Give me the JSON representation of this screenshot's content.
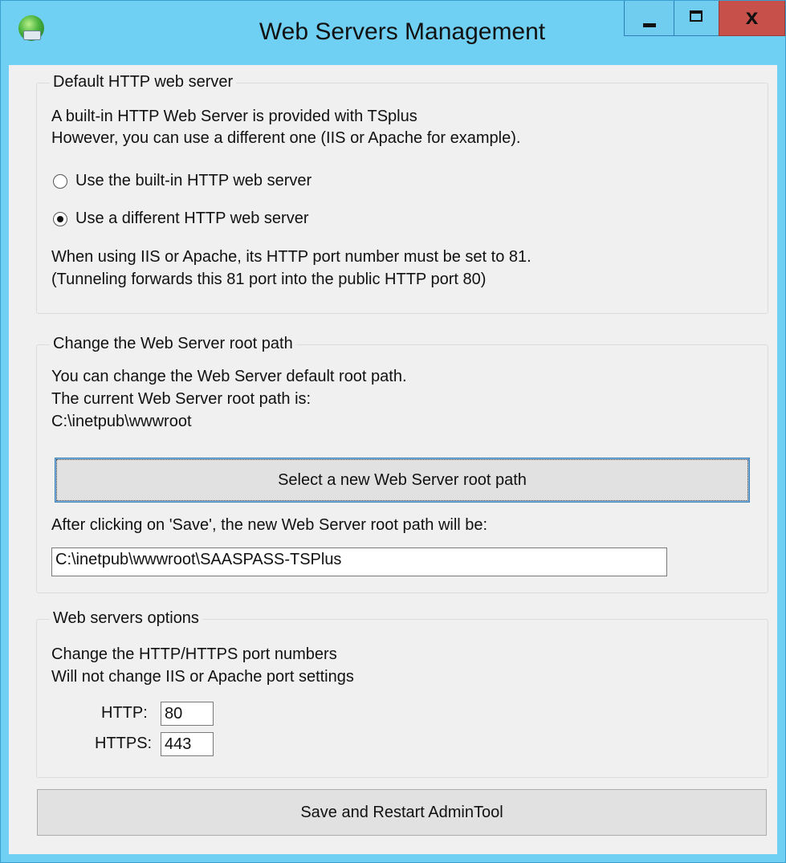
{
  "window": {
    "title": "Web Servers Management",
    "close_glyph": "x",
    "icon": "globe-server-icon"
  },
  "default_server": {
    "legend": "Default HTTP web server",
    "line1": "A built-in HTTP Web Server is provided with TSplus",
    "line2": "However, you can use a different one (IIS or Apache for example).",
    "radio_builtin_label": "Use the built-in HTTP web server",
    "radio_builtin_checked": false,
    "radio_different_label": "Use a different HTTP web server",
    "radio_different_checked": true,
    "note1": "When using IIS or Apache, its HTTP port number must be set to 81.",
    "note2": "(Tunneling forwards this 81 port into the public HTTP port 80)"
  },
  "root_path": {
    "legend": "Change the Web Server root path",
    "line1": "You can change the Web Server default root path.",
    "line2": "The current Web Server root path is:",
    "current_path": "C:\\inetpub\\wwwroot",
    "select_button": "Select a new Web Server root path",
    "after_label": "After clicking on 'Save', the new Web Server root path will be:",
    "new_path_value": "C:\\inetpub\\wwwroot\\SAASPASS-TSPlus"
  },
  "options": {
    "legend": "Web servers options",
    "line1": "Change the HTTP/HTTPS port numbers",
    "line2": "Will not change IIS or Apache port settings",
    "http_label": "HTTP:",
    "http_value": "80",
    "https_label": "HTTPS:",
    "https_value": "443"
  },
  "save_button": "Save and Restart AdminTool"
}
